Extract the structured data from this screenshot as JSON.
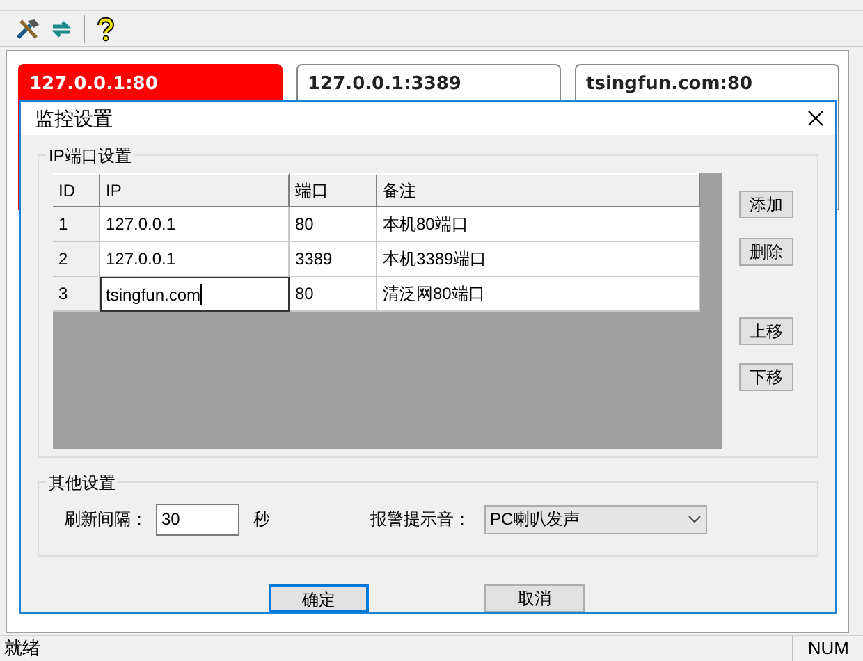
{
  "toolbar": {
    "buttons": [
      {
        "kind": "tools"
      },
      {
        "kind": "refresh"
      },
      {
        "kind": "help"
      }
    ]
  },
  "monitors": [
    {
      "label": "127.0.0.1:80",
      "alarm": true
    },
    {
      "label": "127.0.0.1:3389",
      "alarm": false
    },
    {
      "label": "tsingfun.com:80",
      "alarm": false
    }
  ],
  "dialog": {
    "title": "监控设置",
    "ip_group": {
      "title": "IP端口设置",
      "columns": [
        "ID",
        "IP",
        "端口",
        "备注"
      ],
      "rows": [
        {
          "cells": [
            "1",
            "127.0.0.1",
            "80",
            "本机80端口"
          ],
          "editing": false
        },
        {
          "cells": [
            "2",
            "127.0.0.1",
            "3389",
            "本机3389端口"
          ],
          "editing": false
        },
        {
          "cells": [
            "3",
            "tsingfun.com",
            "80",
            "清泛网80端口"
          ],
          "editing": true
        }
      ],
      "buttons": [
        "添加",
        "删除",
        "上移",
        "下移"
      ]
    },
    "other_group": {
      "title": "其他设置",
      "interval_label": "刷新间隔：",
      "interval_value": "30",
      "interval_unit": "秒",
      "sound_label": "报警提示音：",
      "sound_value": "PC喇叭发声"
    },
    "buttons": [
      {
        "label": "确定",
        "default": true
      },
      {
        "label": "取消",
        "default": false
      }
    ]
  },
  "status_bar": {
    "message": "就绪",
    "indicator": "NUM"
  }
}
